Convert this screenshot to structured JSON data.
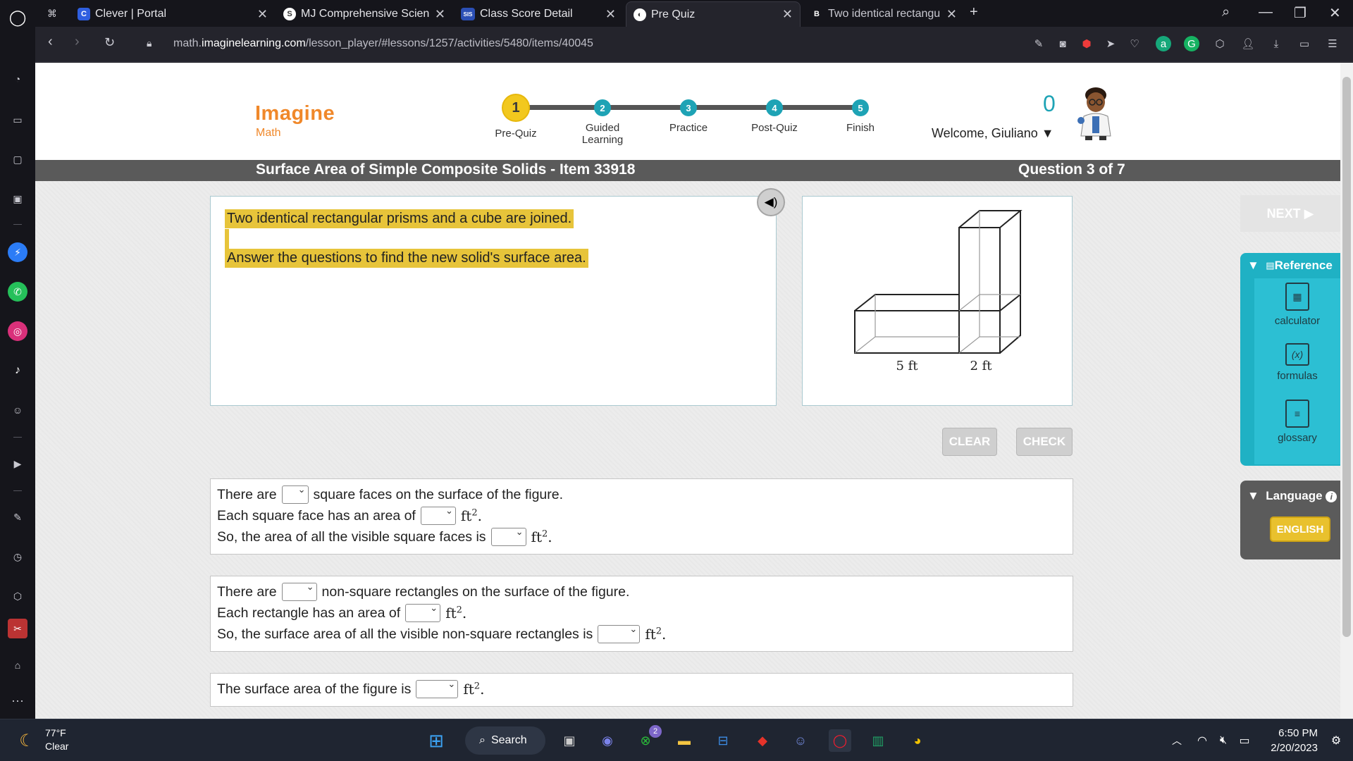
{
  "browser": {
    "tabs": [
      {
        "label": "Clever | Portal",
        "favicon": "C",
        "color": "#2f5fe0"
      },
      {
        "label": "MJ Comprehensive Science",
        "favicon": "S",
        "color": "#3a3a44"
      },
      {
        "label": "Class Score Detail",
        "favicon": "SIS",
        "color": "#2b4fb5"
      },
      {
        "label": "Pre Quiz",
        "favicon": "",
        "color": "#3a3a44"
      },
      {
        "label": "Two identical rectangular p",
        "favicon": "B",
        "color": "#3a3a44"
      }
    ],
    "url_prefix": "math.",
    "url_domain": "imaginelearning.com",
    "url_path": "/lesson_player/#lessons/1257/activities/5480/items/40045"
  },
  "header": {
    "logo_top": "Imagine",
    "logo_bottom": "Math",
    "steps": [
      {
        "number": "1",
        "label": "Pre-Quiz"
      },
      {
        "number": "2",
        "label": "Guided Learning"
      },
      {
        "number": "3",
        "label": "Practice"
      },
      {
        "number": "4",
        "label": "Post-Quiz"
      },
      {
        "number": "5",
        "label": "Finish"
      }
    ],
    "score": "0",
    "welcome": "Welcome, Giuliano"
  },
  "lesson": {
    "title": "Surface Area of Simple Composite Solids - Item 33918",
    "question_counter": "Question 3 of 7",
    "intro_line1": "Two identical rectangular prisms and a cube are joined.",
    "intro_line2": "Answer the questions to find the new solid's surface area.",
    "figure_label_left": "5 ft",
    "figure_label_right": "2 ft"
  },
  "buttons": {
    "clear": "CLEAR",
    "check": "CHECK",
    "next": "NEXT"
  },
  "questions": {
    "q1": {
      "a": "There are",
      "a2": "square faces on the surface of the figure.",
      "b": "Each square face has an area of",
      "c": "So, the area of all the visible square faces is"
    },
    "q2": {
      "a": "There are",
      "a2": "non-square rectangles on the surface of the figure.",
      "b": "Each rectangle has an area of",
      "c": "So, the surface area of all the visible non-square rectangles is"
    },
    "q3": {
      "a": "The surface area of the figure is"
    },
    "unit": "ft",
    "unit_exp": "2"
  },
  "tools": {
    "reference_title": "Reference",
    "calculator": "calculator",
    "formulas": "formulas",
    "glossary": "glossary",
    "language_title": "Language",
    "language_value": "ENGLISH"
  },
  "taskbar": {
    "temperature": "77°F",
    "condition": "Clear",
    "search": "Search",
    "time": "6:50 PM",
    "date": "2/20/2023",
    "badge": "2"
  }
}
